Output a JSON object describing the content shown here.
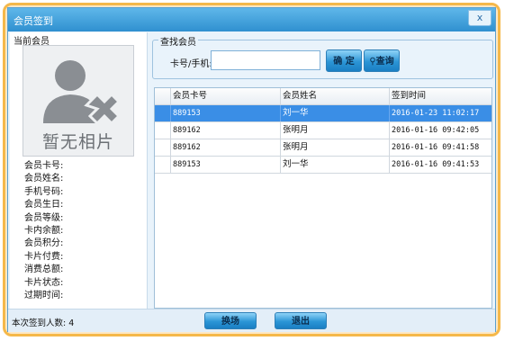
{
  "window": {
    "title": "会员签到",
    "close": "x"
  },
  "member": {
    "section_title": "当前会员",
    "photo_placeholder": "暂无相片",
    "fields": [
      "会员卡号:",
      "会员姓名:",
      "手机号码:",
      "会员生日:",
      "会员等级:",
      "卡内余额:",
      "会员积分:",
      "卡片付费:",
      "消费总额:",
      "卡片状态:",
      "过期时间:"
    ]
  },
  "search": {
    "section_title": "查找会员",
    "label": "卡号/手机:",
    "value": "",
    "confirm_button": "确 定",
    "query_button": "查询"
  },
  "table": {
    "columns": [
      "会员卡号",
      "会员姓名",
      "签到时间"
    ],
    "rows": [
      [
        "889153",
        "刘一华",
        "2016-01-23 11:02:17"
      ],
      [
        "889162",
        "张明月",
        "2016-01-16 09:42:05"
      ],
      [
        "889162",
        "张明月",
        "2016-01-16 09:41:58"
      ],
      [
        "889153",
        "刘一华",
        "2016-01-16 09:41:53"
      ]
    ],
    "selected_index": 0
  },
  "footer": {
    "count_label": "本次签到人数:",
    "count_value": "4",
    "switch_button": "换场",
    "exit_button": "退出"
  },
  "colors": {
    "frame": "#f5b84a",
    "titlebar": "#2f90d0",
    "selection": "#3a8ee6",
    "button": "#2b95d6"
  },
  "icons": {
    "title": "window-icon",
    "placeholder": "user-silhouette-icon",
    "query": "search-icon"
  }
}
